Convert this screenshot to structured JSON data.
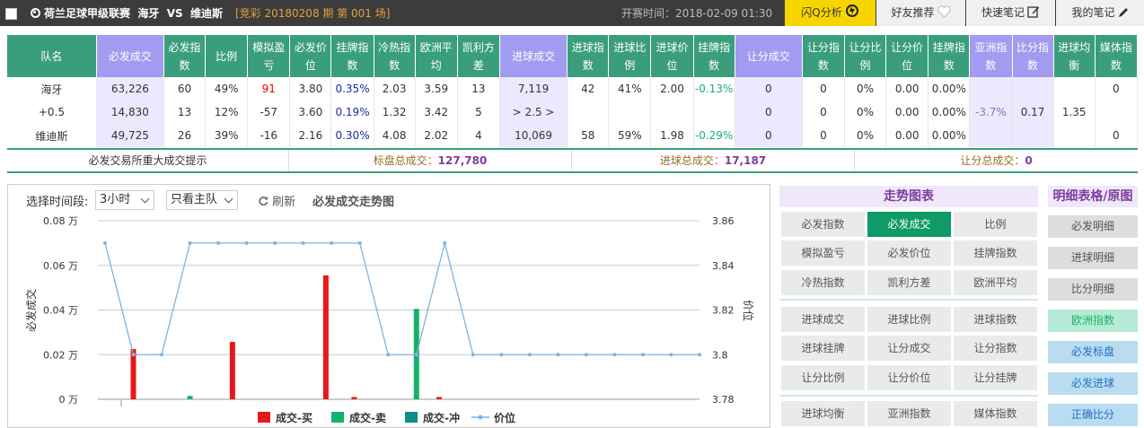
{
  "topbar": {
    "league": "荷兰足球甲级联赛",
    "home": "海牙",
    "vs": "VS",
    "away": "维迪斯",
    "issue": "[竞彩 20180208 期 第 001 场]",
    "kickoff": "开赛时间：2018-02-09 01:30",
    "buttons": [
      "闪Q分析",
      "好友推荐",
      "快速笔记",
      "我的笔记"
    ]
  },
  "table": {
    "headers": [
      "队名",
      "必发成交",
      "必发指数",
      "比例",
      "模拟盈亏",
      "必发价位",
      "挂牌指数",
      "冷热指数",
      "欧洲平均",
      "凯利方差",
      "进球成交",
      "进球指数",
      "进球比例",
      "进球价位",
      "挂牌指数",
      "让分成交",
      "让分指数",
      "让分比例",
      "让分价位",
      "挂牌指数",
      "亚洲指数",
      "比分指数",
      "进球均衡",
      "媒体指数"
    ],
    "rows": [
      [
        "海牙",
        "63,226",
        "60",
        "49%",
        "91",
        "3.80",
        "0.35%",
        "2.03",
        "3.59",
        "13",
        "7,119",
        "42",
        "41%",
        "2.00",
        "-0.13%",
        "0",
        "0",
        "0%",
        "0.00",
        "0.00%",
        "",
        "",
        "",
        "0"
      ],
      [
        "+0.5",
        "14,830",
        "13",
        "12%",
        "-57",
        "3.60",
        "0.19%",
        "1.32",
        "3.42",
        "5",
        "> 2.5 >",
        "",
        "",
        "",
        "",
        "0",
        "0",
        "0%",
        "0.00",
        "0.00%",
        "-3.7%",
        "0.17",
        "1.35",
        ""
      ],
      [
        "维迪斯",
        "49,725",
        "26",
        "39%",
        "-16",
        "2.16",
        "0.30%",
        "4.08",
        "2.02",
        "4",
        "10,069",
        "58",
        "59%",
        "1.98",
        "-0.29%",
        "0",
        "0",
        "0%",
        "0.00",
        "0.00%",
        "",
        "",
        "",
        "0"
      ]
    ]
  },
  "summary": {
    "hint": "必发交易所重大成交提示",
    "home_label": "标盘总成交：",
    "home_value": "127,780",
    "goal_label": "进球总成交：",
    "goal_value": "17,187",
    "handicap_label": "让分总成交：",
    "handicap_value": "0"
  },
  "controls": {
    "period_label": "选择时间段:",
    "period_value": "3小时",
    "team_value": "只看主队",
    "refresh": "刷新",
    "chart_title": "必发成交走势图"
  },
  "chart_data": {
    "type": "bar+line",
    "title": "必发成交走势图",
    "ylabel": "必发成交",
    "y2label": "价位",
    "ylim": [
      0,
      0.08
    ],
    "y2lim": [
      3.78,
      3.86
    ],
    "yticks": [
      "0 万",
      "0.02 万",
      "0.04 万",
      "0.06 万",
      "0.08 万"
    ],
    "y2ticks": [
      "3.78",
      "3.8",
      "3.82",
      "3.84",
      "3.86"
    ],
    "legend": [
      "成交-买",
      "成交-卖",
      "成交-冲",
      "价位"
    ],
    "colors": {
      "buy": "#e81818",
      "sell": "#12b26a",
      "flush": "#0f8c8c",
      "price": "#7fb3e0"
    },
    "price_series": [
      3.85,
      3.8,
      3.8,
      3.85,
      3.85,
      3.85,
      3.85,
      3.85,
      3.85,
      3.85,
      3.8,
      3.8,
      3.85,
      3.8,
      3.8,
      3.8,
      3.8,
      3.8,
      3.8,
      3.8,
      3.8,
      3.8
    ],
    "bars": [
      {
        "index": 1,
        "series": "buy",
        "value": 0.0225
      },
      {
        "index": 3,
        "series": "sell",
        "value": 0.0015
      },
      {
        "index": 4.5,
        "series": "buy",
        "value": 0.0257
      },
      {
        "index": 7.8,
        "series": "buy",
        "value": 0.0555
      },
      {
        "index": 8.8,
        "series": "buy",
        "value": 0.001
      },
      {
        "index": 11,
        "series": "sell",
        "value": 0.0405
      },
      {
        "index": 11.8,
        "series": "buy",
        "value": 0.001
      }
    ]
  },
  "trend_panel": {
    "title": "走势图表",
    "buttons": [
      "必发指数",
      "必发成交",
      "比例",
      "模拟盈亏",
      "必发价位",
      "挂牌指数",
      "冷热指数",
      "凯利方差",
      "欧洲平均",
      "进球成交",
      "进球比例",
      "进球指数",
      "进球挂牌",
      "让分成交",
      "让分指数",
      "让分比例",
      "让分价位",
      "让分挂牌",
      "进球均衡",
      "亚洲指数",
      "媒体指数"
    ],
    "active": "必发成交"
  },
  "detail_panel": {
    "title": "明细表格/原图",
    "buttons": [
      "必发明细",
      "进球明细",
      "比分明细",
      "欧洲指数",
      "必发标盘",
      "必发进球",
      "正确比分"
    ]
  }
}
